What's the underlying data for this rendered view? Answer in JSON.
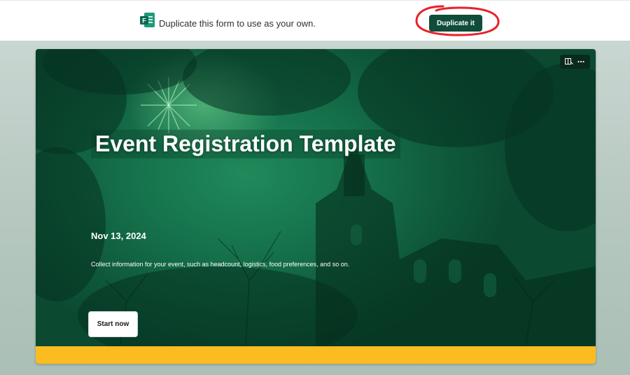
{
  "banner": {
    "icon": "microsoft-forms-icon",
    "text": "Duplicate this form to use as your own.",
    "duplicate_label": "Duplicate it"
  },
  "form": {
    "title": "Event Registration Template",
    "date": "Nov 13, 2024",
    "description": "Collect information for your event, such as headcount, logistics, food preferences, and so on.",
    "start_label": "Start now",
    "tools": [
      "immersive-reader-icon",
      "more-options-icon"
    ]
  },
  "colors": {
    "duplicate_button": "#0f4d3a",
    "card_green": "#15704a",
    "accent_band": "#fbbc21",
    "annotation": "#e8212a"
  }
}
